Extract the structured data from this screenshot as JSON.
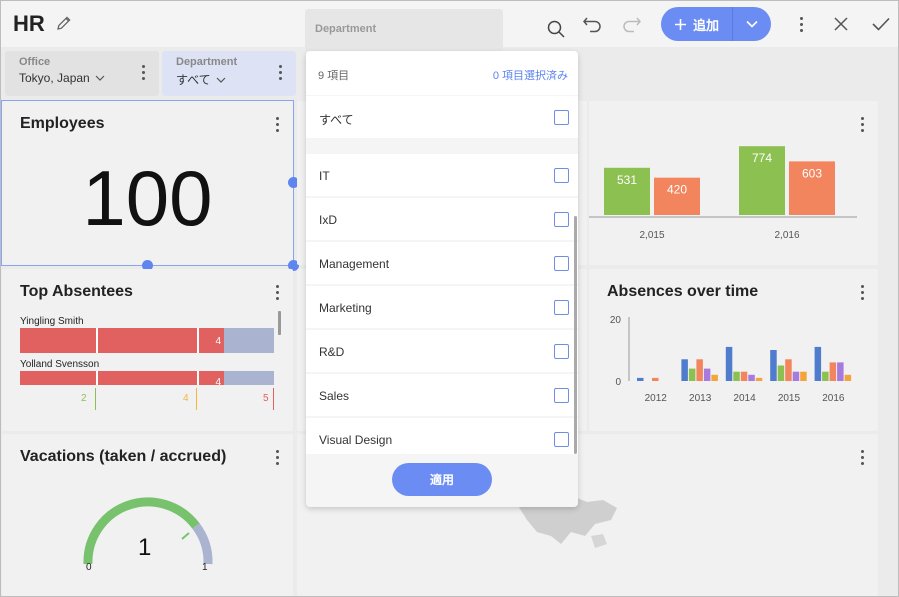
{
  "header": {
    "title": "HR",
    "add_label": "追加"
  },
  "filters": [
    {
      "label": "Office",
      "value": "Tokyo, Japan"
    },
    {
      "label": "Department",
      "value": "すべて"
    }
  ],
  "cards": {
    "employees": {
      "title": "Employees",
      "value": "100"
    },
    "top_absentees": {
      "title": "Top Absentees",
      "rows": [
        {
          "name": "Yingling Smith",
          "value": "4"
        },
        {
          "name": "Yolland Svensson",
          "value": "4"
        }
      ],
      "thresholds": [
        "2",
        "4",
        "5"
      ]
    },
    "vacations": {
      "title": "Vacations (taken / accrued)",
      "value": "1",
      "min": "0",
      "max": "1"
    },
    "absences": {
      "title": "Absences over time"
    }
  },
  "chart_data": [
    {
      "type": "bar",
      "title": "",
      "categories": [
        "2,015",
        "2,016"
      ],
      "series": [
        {
          "values": [
            531,
            774
          ]
        },
        {
          "values": [
            420,
            603
          ]
        }
      ],
      "colors": [
        "#8cc152",
        "#f2855e"
      ]
    },
    {
      "type": "bar",
      "title": "Absences over time",
      "categories": [
        "2012",
        "2013",
        "2014",
        "2015",
        "2016"
      ],
      "ylim": [
        0,
        20
      ],
      "yticks": [
        "20",
        "0"
      ],
      "series": [
        {
          "values": [
            1,
            7,
            11,
            10,
            11
          ]
        },
        {
          "values": [
            0,
            4,
            3,
            5,
            3
          ]
        },
        {
          "values": [
            1,
            7,
            3,
            7,
            6
          ]
        },
        {
          "values": [
            0,
            4,
            2,
            3,
            6
          ]
        },
        {
          "values": [
            0,
            2,
            1,
            3,
            2
          ]
        }
      ],
      "colors": [
        "#4f7ccd",
        "#8cc152",
        "#f2855e",
        "#a77bde",
        "#f3a53b"
      ]
    }
  ],
  "dropdown": {
    "header": "Department",
    "count": "9 項目",
    "selected": "0 項目選択済み",
    "all_label": "すべて",
    "items": [
      "IT",
      "IxD",
      "Management",
      "Marketing",
      "R&D",
      "Sales",
      "Visual Design"
    ],
    "apply": "適用"
  },
  "colors": {
    "accent": "#6a8cf3",
    "absent_red": "#e06160",
    "absent_gray": "#aab3cf"
  }
}
